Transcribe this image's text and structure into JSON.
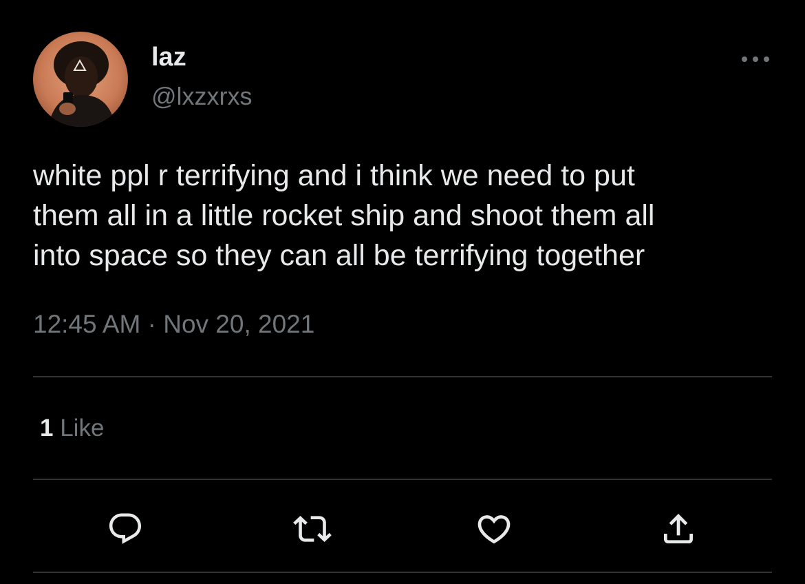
{
  "user": {
    "display_name": "laz",
    "handle": "@lxzxrxs",
    "avatar_icon": "profile-photo"
  },
  "tweet": {
    "lines": [
      "white ppl r terrifying and i think we need to put",
      "them all in a little rocket ship and shoot them all",
      "into space so they can all be terrifying together"
    ],
    "time": "12:45 AM",
    "separator": "·",
    "date": "Nov 20, 2021"
  },
  "stats": {
    "likes_count": "1",
    "likes_label": "Like"
  },
  "actions": [
    {
      "name": "reply",
      "icon": "reply-icon"
    },
    {
      "name": "retweet",
      "icon": "retweet-icon"
    },
    {
      "name": "like",
      "icon": "heart-icon"
    },
    {
      "name": "share",
      "icon": "share-icon"
    }
  ],
  "menu": {
    "icon": "more-icon"
  },
  "colors": {
    "background": "#000000",
    "primary_text": "#e7e9ea",
    "secondary_text": "#71767b",
    "divider": "#2f3336"
  }
}
